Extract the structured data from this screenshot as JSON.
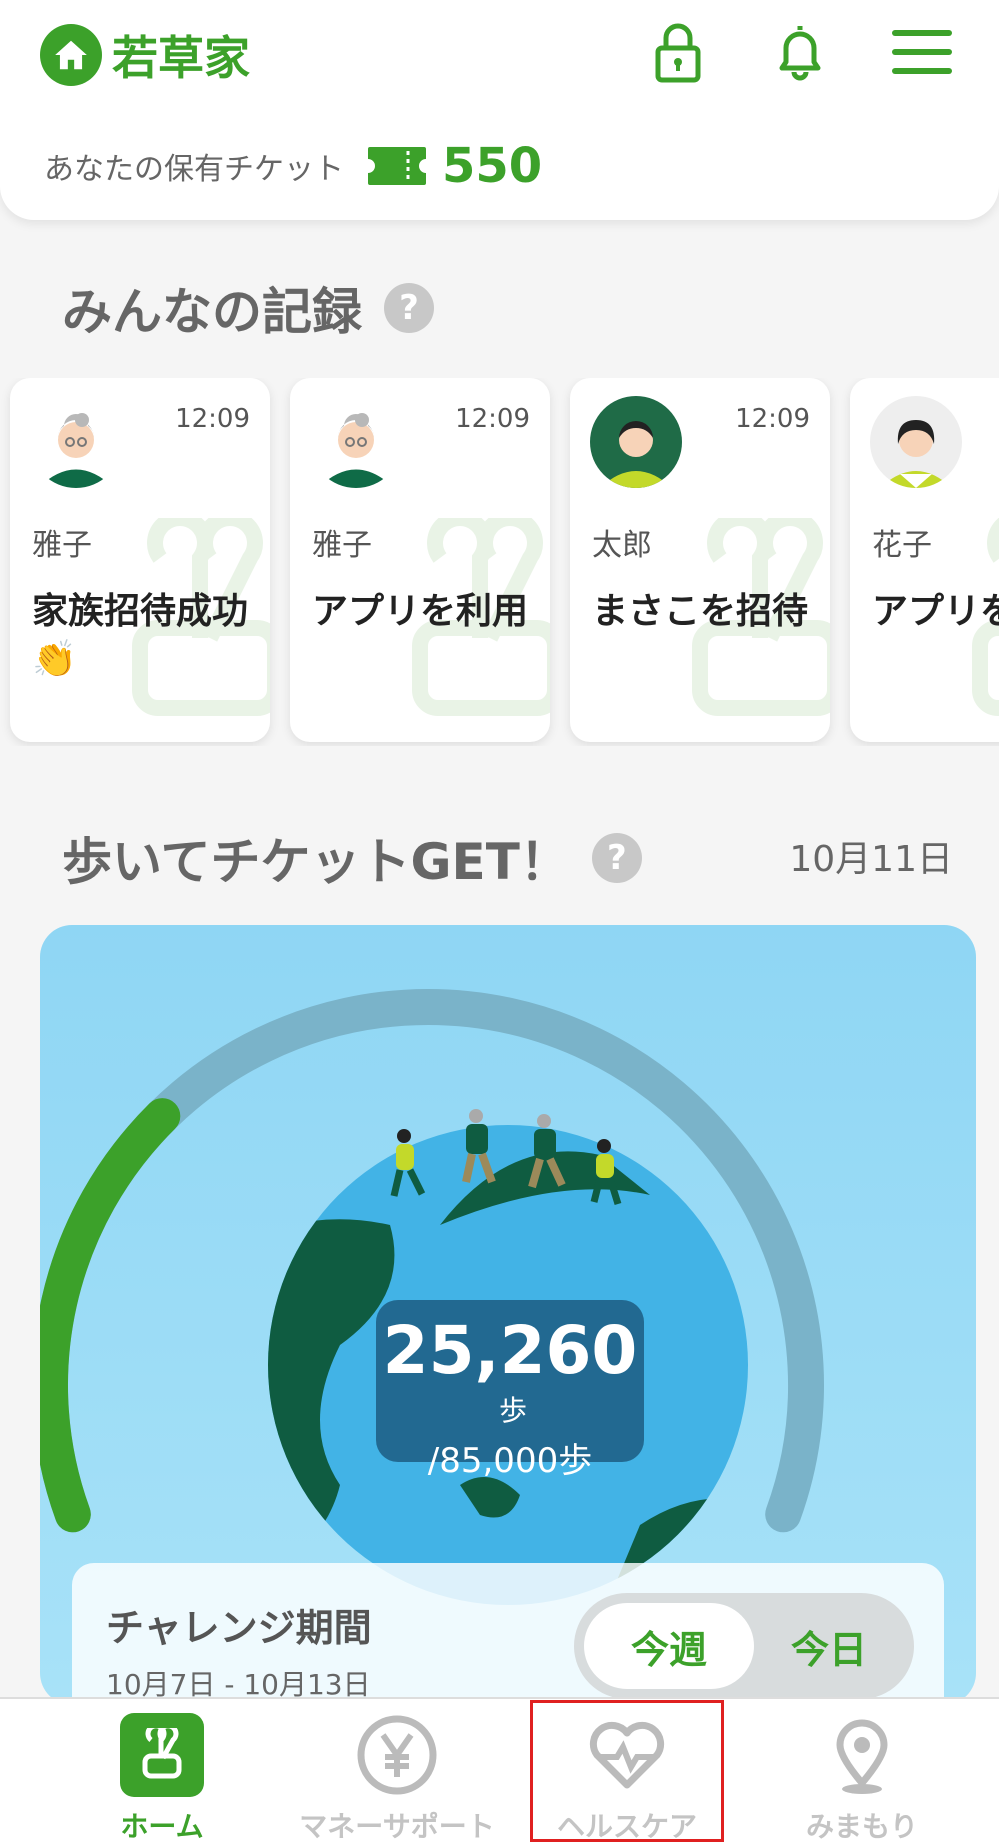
{
  "header": {
    "app_name": "若草家",
    "ticket_label": "あなたの保有チケット",
    "ticket_count": "550",
    "icons": [
      "home-icon",
      "lock-icon",
      "bell-icon",
      "menu-icon"
    ]
  },
  "records": {
    "title": "みんなの記録",
    "help": "?",
    "cards": [
      {
        "time": "12:09",
        "name": "雅子",
        "text": "家族招待成功👏"
      },
      {
        "time": "12:09",
        "name": "雅子",
        "text": "アプリを利用"
      },
      {
        "time": "12:09",
        "name": "太郎",
        "text": "まさこを招待"
      },
      {
        "time": "",
        "name": "花子",
        "text": "アプリを利用"
      }
    ]
  },
  "walk": {
    "title": "歩いてチケットGET！",
    "help": "?",
    "date": "10月11日",
    "steps": "25,260",
    "steps_unit": "歩",
    "goal": "/85,000歩",
    "progress": 0.297,
    "challenge_title": "チャレンジ期間",
    "challenge_range": "10月7日 - 10月13日",
    "toggle_week": "今週",
    "toggle_today": "今日"
  },
  "nav": {
    "items": [
      {
        "label": "ホーム",
        "icon": "home-app-icon",
        "active": true
      },
      {
        "label": "マネーサポート",
        "icon": "yen-icon",
        "active": false
      },
      {
        "label": "ヘルスケア",
        "icon": "heartbeat-icon",
        "active": false
      },
      {
        "label": "みまもり",
        "icon": "location-pin-icon",
        "active": false
      }
    ]
  },
  "colors": {
    "accent": "#3ca12a",
    "dark_green": "#0f5c41",
    "sky": "#8fd6f4"
  }
}
